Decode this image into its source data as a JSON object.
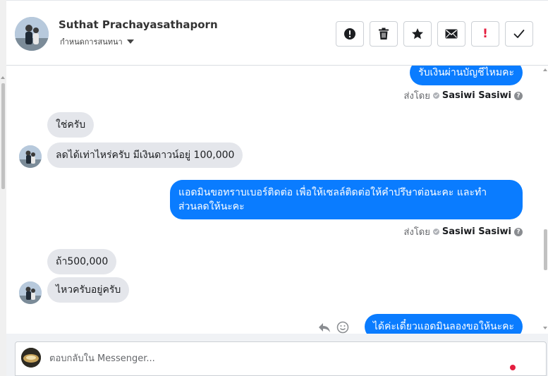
{
  "header": {
    "contact_name": "Suthat Prachayasathaporn",
    "contact_sub": "กำหนดการสนทนา",
    "buttons": {
      "alert": "alert-circle-icon",
      "trash": "trash-icon",
      "star": "star-icon",
      "mail": "envelope-icon",
      "important": "!",
      "done": "checkmark-icon"
    }
  },
  "messages": [
    {
      "side": "out",
      "text": "รับเงินผ่านบัญชีไหมคะ"
    },
    {
      "side": "meta",
      "prefix": "ส่งโดย",
      "sender": "Sasiwi Sasiwi",
      "help": "?"
    },
    {
      "side": "in",
      "text": "ใช่ครับ"
    },
    {
      "side": "in",
      "text": "ลดได้เท่าไหร่ครับ มีเงินดาวน์อยู่ 100,000"
    },
    {
      "side": "out",
      "text": "แอดมินขอทราบเบอร์ติดต่อ เพื่อให้เซลล์ติดต่อให้คำปรึษาต่อนะคะ และทำส่วนลดให้นะคะ"
    },
    {
      "side": "meta",
      "prefix": "ส่งโดย",
      "sender": "Sasiwi Sasiwi",
      "help": "?"
    },
    {
      "side": "in",
      "text": "ถ้า500,000"
    },
    {
      "side": "in",
      "text": "ไหวครับอยู่ครับ"
    },
    {
      "side": "out",
      "text": "ได้ค่ะเดี๋ยวแอดมินลองขอให้นะคะ"
    }
  ],
  "composer": {
    "placeholder": "ตอบกลับใน Messenger..."
  },
  "colors": {
    "outgoing_bubble": "#0a7cff",
    "incoming_bubble": "#e4e6eb",
    "important_red": "#e41e3f"
  }
}
